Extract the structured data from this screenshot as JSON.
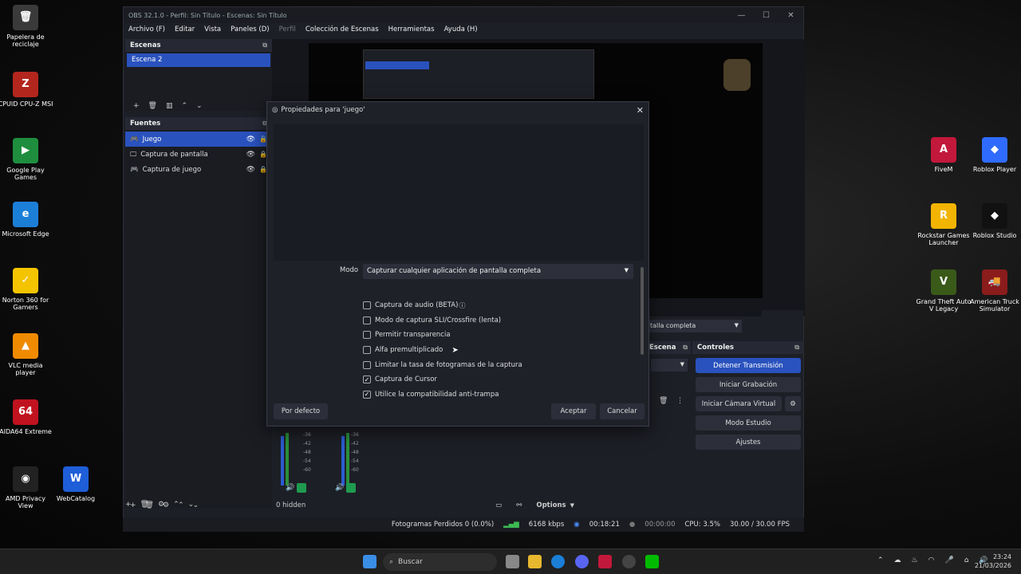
{
  "desktop": {
    "left_icons": [
      {
        "label": "Papelera de reciclaje",
        "glyph": "🗑",
        "color": "#3a3a3a"
      },
      {
        "label": "CPUID CPU-Z MSI",
        "glyph": "Z",
        "color": "#b3261e"
      },
      {
        "label": "Google Play Games",
        "glyph": "▶",
        "color": "#1e8e3e"
      },
      {
        "label": "Microsoft Edge",
        "glyph": "e",
        "color": "#1b7fd8"
      },
      {
        "label": "Norton 360 for Gamers",
        "glyph": "✓",
        "color": "#f5c400"
      },
      {
        "label": "VLC media player",
        "glyph": "▲",
        "color": "#f08a00"
      },
      {
        "label": "AIDA64 Extreme",
        "glyph": "64",
        "color": "#c1121f"
      },
      {
        "label": "AMD Privacy View",
        "glyph": "◉",
        "color": "#222"
      },
      {
        "label": "WebCatalog",
        "glyph": "W",
        "color": "#1e5ed8"
      }
    ],
    "right_icons": [
      {
        "label": "FiveM",
        "glyph": "A",
        "color": "#c2183b"
      },
      {
        "label": "Roblox Player",
        "glyph": "◆",
        "color": "#2f6bff"
      },
      {
        "label": "Rockstar Games Launcher",
        "glyph": "R",
        "color": "#f2b400"
      },
      {
        "label": "Roblox Studio",
        "glyph": "◆",
        "color": "#111"
      },
      {
        "label": "Grand Theft Auto V Legacy",
        "glyph": "V",
        "color": "#3a5a1a"
      },
      {
        "label": "American Truck Simulator",
        "glyph": "🚚",
        "color": "#8a1c1c"
      }
    ]
  },
  "obs": {
    "title": "OBS 32.1.0 - Perfil: Sin Título - Escenas: Sin Título",
    "menu": [
      "Archivo (F)",
      "Editar",
      "Vista",
      "Paneles (D)",
      "Perfil",
      "Colección de Escenas",
      "Herramientas",
      "Ayuda (H)"
    ],
    "scenes_title": "Escenas",
    "scenes": [
      "Escena 2"
    ],
    "sources_title": "Fuentes",
    "sources": [
      {
        "name": "Juego",
        "icon": "gamepad-icon"
      },
      {
        "name": "Captura de pantalla",
        "icon": "monitor-icon"
      },
      {
        "name": "Captura de juego",
        "icon": "gamepad-icon"
      }
    ],
    "scene_transitions_title": "Escena",
    "mode_partial": "talla completa",
    "controls_title": "Controles",
    "controls": {
      "stop_stream": "Detener Transmisión",
      "start_recording": "Iniciar Grabación",
      "virtual_camera": "Iniciar Cámara Virtual",
      "studio_mode": "Modo Estudio",
      "settings": "Ajustes"
    },
    "mixer": {
      "hidden": "0 hidden",
      "options": "Options",
      "db_ticks": [
        "-36",
        "-42",
        "-48",
        "-54",
        "-60"
      ]
    },
    "status": {
      "dropped": "Fotogramas Perdidos 0 (0.0%)",
      "bitrate": "6168 kbps",
      "stream_time": "00:18:21",
      "rec_time": "00:00:00",
      "cpu": "CPU: 3.5%",
      "fps": "30.00 / 30.00 FPS"
    }
  },
  "dialog": {
    "title": "Propiedades para 'juego'",
    "mode_label": "Modo",
    "mode_value": "Capturar cualquier aplicación de pantalla completa",
    "checkboxes": [
      {
        "label": "Captura de audio (BETA)",
        "checked": false,
        "help": true
      },
      {
        "label": "Modo de captura SLI/Crossfire (lenta)",
        "checked": false
      },
      {
        "label": "Permitir transparencia",
        "checked": false
      },
      {
        "label": "Alfa premultiplicado",
        "checked": false
      },
      {
        "label": "Limitar la tasa de fotogramas de la captura",
        "checked": false
      },
      {
        "label": "Captura de Cursor",
        "checked": true
      },
      {
        "label": "Utilice la compatibilidad anti-trampa",
        "checked": true
      }
    ],
    "defaults_button": "Por defecto",
    "accept_button": "Aceptar",
    "cancel_button": "Cancelar"
  },
  "taskbar": {
    "search_placeholder": "Buscar",
    "time": "23:24",
    "date": "21/03/2026"
  }
}
